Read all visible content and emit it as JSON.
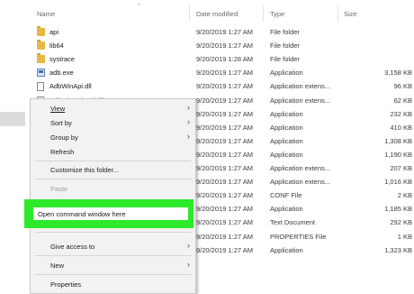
{
  "header": {
    "name": "Name",
    "date": "Date modified",
    "type": "Type",
    "size": "Size"
  },
  "files": [
    {
      "name": "api",
      "date": "9/20/2019 1:27 AM",
      "type": "File folder",
      "size": "",
      "icon": "folder-icon"
    },
    {
      "name": "lib64",
      "date": "9/20/2019 1:27 AM",
      "type": "File folder",
      "size": "",
      "icon": "folder-icon"
    },
    {
      "name": "systrace",
      "date": "9/20/2019 1:28 AM",
      "type": "File folder",
      "size": "",
      "icon": "folder-icon"
    },
    {
      "name": "adb.exe",
      "date": "9/20/2019 1:27 AM",
      "type": "Application",
      "size": "3,158 KB",
      "icon": "exe-icon"
    },
    {
      "name": "AdbWinApi.dll",
      "date": "9/20/2019 1:27 AM",
      "type": "Application extens...",
      "size": "96 KB",
      "icon": "dll-icon"
    },
    {
      "name": "AdbWinUsbApi.dll",
      "date": "9/20/2019 1:27 AM",
      "type": "Application extens...",
      "size": "62 KB",
      "icon": "dll-icon"
    },
    {
      "name": "",
      "date": "9/20/2019 1:27 AM",
      "type": "Application",
      "size": "232 KB",
      "icon": ""
    },
    {
      "name": "",
      "date": "9/20/2019 1:27 AM",
      "type": "Application",
      "size": "410 KB",
      "icon": ""
    },
    {
      "name": "",
      "date": "9/20/2019 1:27 AM",
      "type": "Application",
      "size": "1,308 KB",
      "icon": ""
    },
    {
      "name": "",
      "date": "9/20/2019 1:27 AM",
      "type": "Application",
      "size": "1,190 KB",
      "icon": ""
    },
    {
      "name": "",
      "date": "9/20/2019 1:27 AM",
      "type": "Application extens...",
      "size": "207 KB",
      "icon": ""
    },
    {
      "name": "",
      "date": "9/20/2019 1:27 AM",
      "type": "Application extens...",
      "size": "1,016 KB",
      "icon": ""
    },
    {
      "name": "",
      "date": "9/20/2019 1:27 AM",
      "type": "CONF File",
      "size": "2 KB",
      "icon": ""
    },
    {
      "name": "",
      "date": "9/20/2019 1:27 AM",
      "type": "Application",
      "size": "1,185 KB",
      "icon": ""
    },
    {
      "name": "",
      "date": "9/20/2019 1:27 AM",
      "type": "Text Document",
      "size": "292 KB",
      "icon": ""
    },
    {
      "name": "",
      "date": "9/20/2019 1:27 AM",
      "type": "PROPERTIES File",
      "size": "1 KB",
      "icon": ""
    },
    {
      "name": "",
      "date": "9/20/2019 1:27 AM",
      "type": "Application",
      "size": "1,323 KB",
      "icon": ""
    }
  ],
  "menu": {
    "view": "View",
    "sort_by": "Sort by",
    "group_by": "Group by",
    "refresh": "Refresh",
    "customize": "Customize this folder...",
    "paste": "Paste",
    "open_command": "Open command window here",
    "give_access": "Give access to",
    "new": "New",
    "properties": "Properties"
  },
  "colors": {
    "highlight": "#2cea2a",
    "menu_bg": "#f2f2f2"
  }
}
